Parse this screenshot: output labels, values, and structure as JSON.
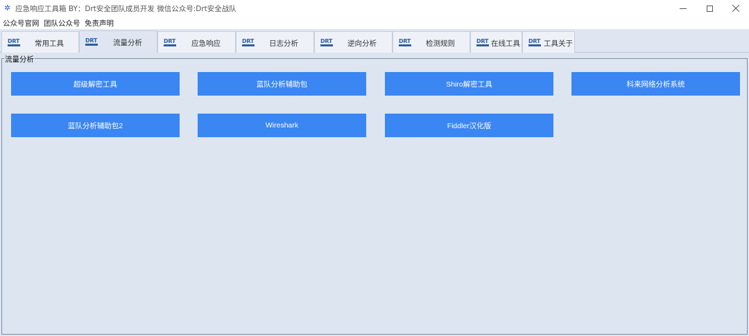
{
  "window": {
    "title": "应急响应工具箱   BY：Drt安全团队成员开发    微信公众号:Drt安全战队",
    "icon": "star-icon"
  },
  "menu": {
    "items": [
      "公众号官网",
      "团队公众号",
      "免责声明"
    ]
  },
  "tabs": [
    {
      "label": "常用工具",
      "logo": "DRT",
      "active": false
    },
    {
      "label": "流量分析",
      "logo": "DRT",
      "active": true
    },
    {
      "label": "应急响应",
      "logo": "DRT",
      "active": false
    },
    {
      "label": "日志分析",
      "logo": "DRT",
      "active": false
    },
    {
      "label": "逆向分析",
      "logo": "DRT",
      "active": false
    },
    {
      "label": "检测规则",
      "logo": "DRT",
      "active": false
    },
    {
      "label": "在线工具",
      "logo": "DRT",
      "active": false
    },
    {
      "label": "工具关于",
      "logo": "DRT",
      "active": false
    }
  ],
  "group": {
    "title": "流量分析",
    "buttons": [
      "超级解密工具",
      "蓝队分析辅助包",
      "Shiro解密工具",
      "科来网络分析系统",
      "蓝队分析辅助包2",
      "Wireshark",
      "Fiddler汉化版"
    ]
  },
  "colors": {
    "accent": "#3a86f2",
    "panel": "#dde5f1",
    "tabstrip": "#dfe6f1"
  }
}
